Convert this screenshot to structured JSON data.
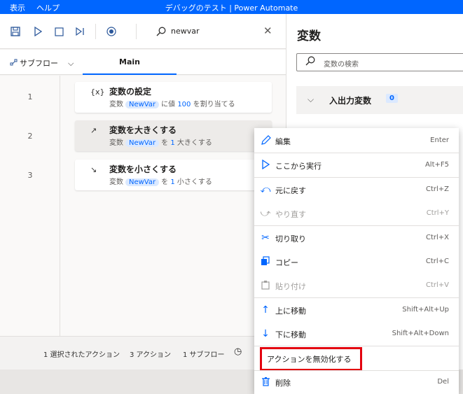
{
  "titlebar": {
    "menu_view": "表示",
    "menu_help": "ヘルプ",
    "title": "デバッグのテスト | Power Automate"
  },
  "toolbar": {
    "search_value": "newvar"
  },
  "tabs": {
    "subflow_label": "サブフロー",
    "main_label": "Main"
  },
  "actions": [
    {
      "line": "1",
      "icon": "{x}",
      "title": "変数の設定",
      "desc_prefix": "変数",
      "var": "NewVar",
      "desc_mid": "に値",
      "value": "100",
      "desc_suffix": "を割り当てる"
    },
    {
      "line": "2",
      "icon": "↗",
      "title": "変数を大きくする",
      "desc_prefix": "変数",
      "var": "NewVar",
      "desc_mid": "を",
      "value": "1",
      "desc_suffix": "大きくする"
    },
    {
      "line": "3",
      "icon": "↘",
      "title": "変数を小さくする",
      "desc_prefix": "変数",
      "var": "NewVar",
      "desc_mid": "を",
      "value": "1",
      "desc_suffix": "小さくする"
    }
  ],
  "statusbar": {
    "selected": "1 選択されたアクション",
    "actions": "3 アクション",
    "subflows": "1 サブフロー"
  },
  "variables_pane": {
    "title": "変数",
    "search_placeholder": "変数の検索",
    "io_section": "入出力変数",
    "io_count": "0"
  },
  "context_menu": {
    "items": [
      {
        "label": "編集",
        "shortcut": "Enter",
        "icon": "pencil-icon"
      },
      {
        "label": "ここから実行",
        "shortcut": "Alt+F5",
        "icon": "play-icon"
      },
      {
        "label": "元に戻す",
        "shortcut": "Ctrl+Z",
        "icon": "undo-icon"
      },
      {
        "label": "やり直す",
        "shortcut": "Ctrl+Y",
        "icon": "redo-icon"
      },
      {
        "label": "切り取り",
        "shortcut": "Ctrl+X",
        "icon": "scissors-icon"
      },
      {
        "label": "コピー",
        "shortcut": "Ctrl+C",
        "icon": "copy-icon"
      },
      {
        "label": "貼り付け",
        "shortcut": "Ctrl+V",
        "icon": "paste-icon"
      },
      {
        "label": "上に移動",
        "shortcut": "Shift+Alt+Up",
        "icon": "arrow-up-icon"
      },
      {
        "label": "下に移動",
        "shortcut": "Shift+Alt+Down",
        "icon": "arrow-down-icon"
      },
      {
        "label": "アクションを無効化する",
        "shortcut": "",
        "icon": ""
      },
      {
        "label": "削除",
        "shortcut": "Del",
        "icon": "trash-icon"
      }
    ]
  },
  "colors": {
    "accent": "#0066ff",
    "highlight": "#e3000f"
  }
}
